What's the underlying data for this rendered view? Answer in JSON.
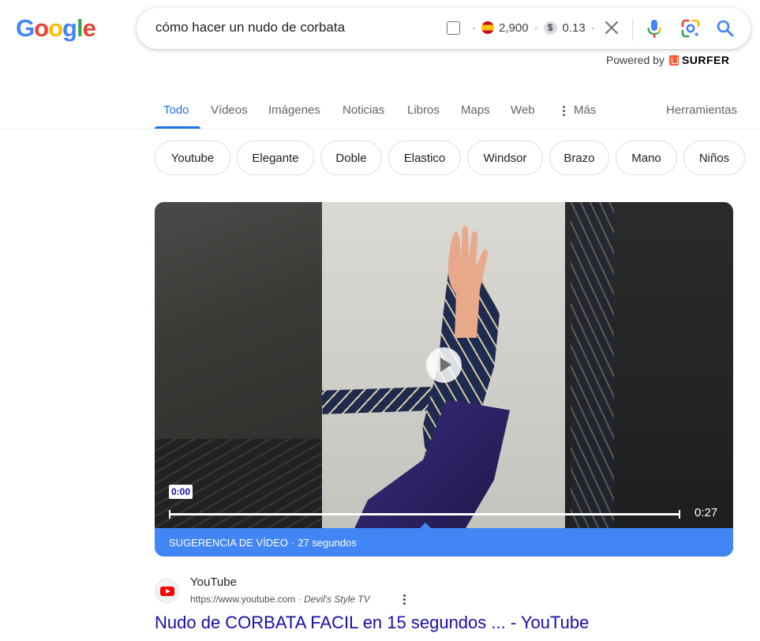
{
  "logo": {
    "letters": [
      "G",
      "o",
      "o",
      "g",
      "l",
      "e"
    ],
    "colors": [
      "#4285f4",
      "#ea4335",
      "#fbbc05",
      "#4285f4",
      "#34a853",
      "#ea4335"
    ]
  },
  "search": {
    "query": "cómo hacer un nudo de corbata",
    "volume": "2,900",
    "cpc": "0.13",
    "dollar_symbol": "$",
    "separator": "·"
  },
  "powered_by": {
    "label": "Powered by",
    "brand": "SURFER"
  },
  "tabs": [
    {
      "label": "Todo",
      "active": true
    },
    {
      "label": "Vídeos"
    },
    {
      "label": "Imágenes"
    },
    {
      "label": "Noticias"
    },
    {
      "label": "Libros"
    },
    {
      "label": "Maps"
    },
    {
      "label": "Web"
    },
    {
      "label": "Más"
    },
    {
      "label": "Herramientas"
    }
  ],
  "chips": [
    "Youtube",
    "Elegante",
    "Doble",
    "Elastico",
    "Windsor",
    "Brazo",
    "Mano",
    "Niños"
  ],
  "video": {
    "current_time": "0:00",
    "duration": "0:27",
    "progress": 0,
    "suggestion_label": "SUGERENCIA DE VÍDEO",
    "suggestion_length": "27 segundos"
  },
  "result": {
    "site_name": "YouTube",
    "url": "https://www.youtube.com",
    "crumb_separator": "›",
    "channel": "Devil's Style TV",
    "title": "Nudo de CORBATA FACIL en 15 segundos ... - YouTube"
  },
  "colors": {
    "accent": "#1a73e8",
    "link": "#1a0dab",
    "suggest_bar": "#4285f4"
  }
}
